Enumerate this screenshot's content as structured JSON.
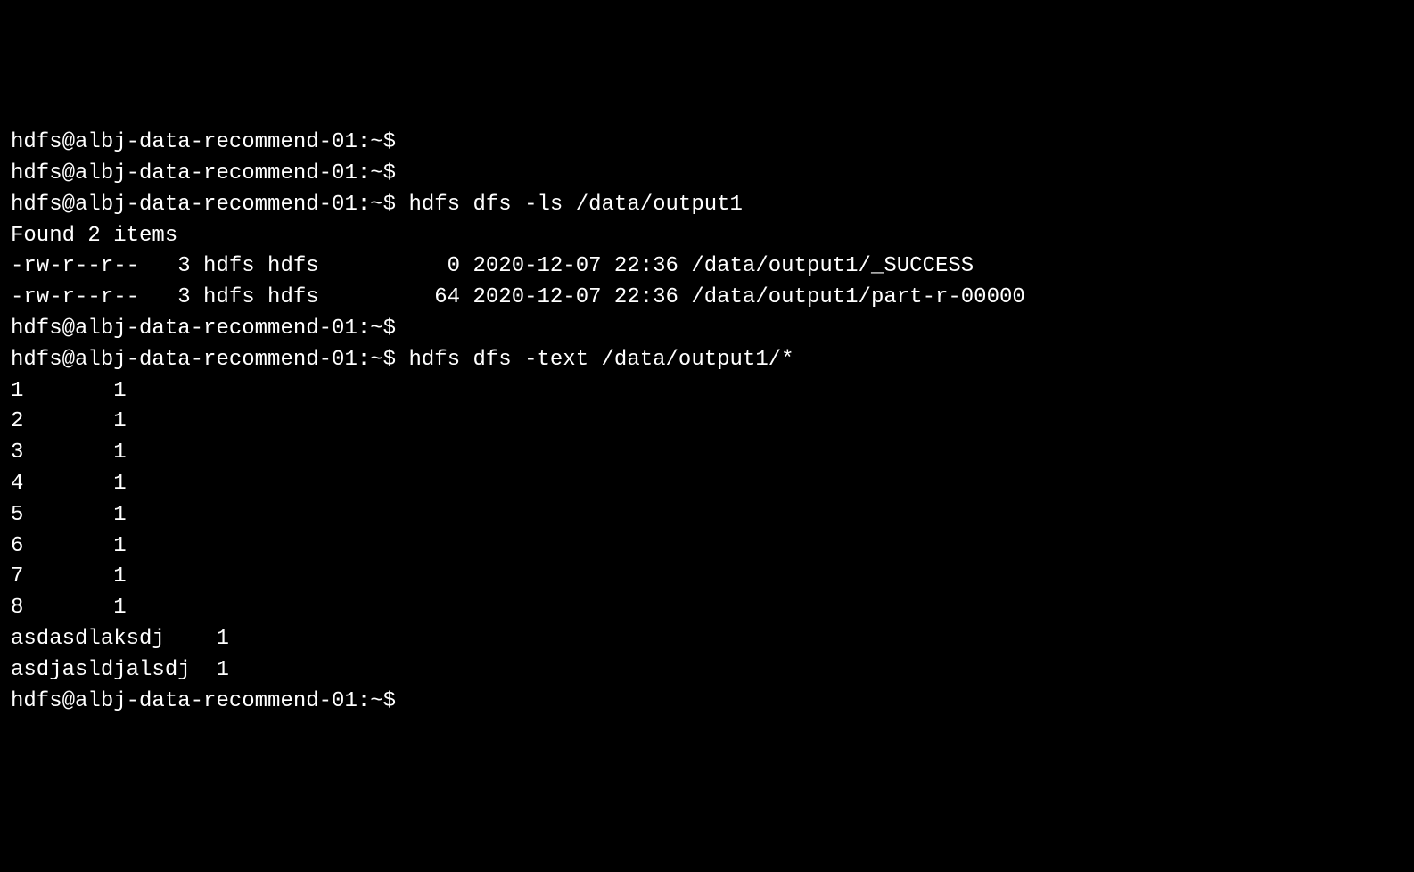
{
  "terminal": {
    "lines": [
      {
        "prompt": "hdfs@albj-data-recommend-01:~$",
        "command": ""
      },
      {
        "prompt": "hdfs@albj-data-recommend-01:~$",
        "command": ""
      },
      {
        "prompt": "hdfs@albj-data-recommend-01:~$",
        "command": " hdfs dfs -ls /data/output1"
      },
      {
        "output": "Found 2 items"
      },
      {
        "output": "-rw-r--r--   3 hdfs hdfs          0 2020-12-07 22:36 /data/output1/_SUCCESS"
      },
      {
        "output": "-rw-r--r--   3 hdfs hdfs         64 2020-12-07 22:36 /data/output1/part-r-00000"
      },
      {
        "prompt": "hdfs@albj-data-recommend-01:~$",
        "command": ""
      },
      {
        "prompt": "hdfs@albj-data-recommend-01:~$",
        "command": " hdfs dfs -text /data/output1/*"
      },
      {
        "output": "1       1"
      },
      {
        "output": "2       1"
      },
      {
        "output": "3       1"
      },
      {
        "output": "4       1"
      },
      {
        "output": "5       1"
      },
      {
        "output": "6       1"
      },
      {
        "output": "7       1"
      },
      {
        "output": "8       1"
      },
      {
        "output": "asdasdlaksdj    1"
      },
      {
        "output": "asdjasldjalsdj  1"
      },
      {
        "prompt": "hdfs@albj-data-recommend-01:~$",
        "command": ""
      }
    ]
  }
}
